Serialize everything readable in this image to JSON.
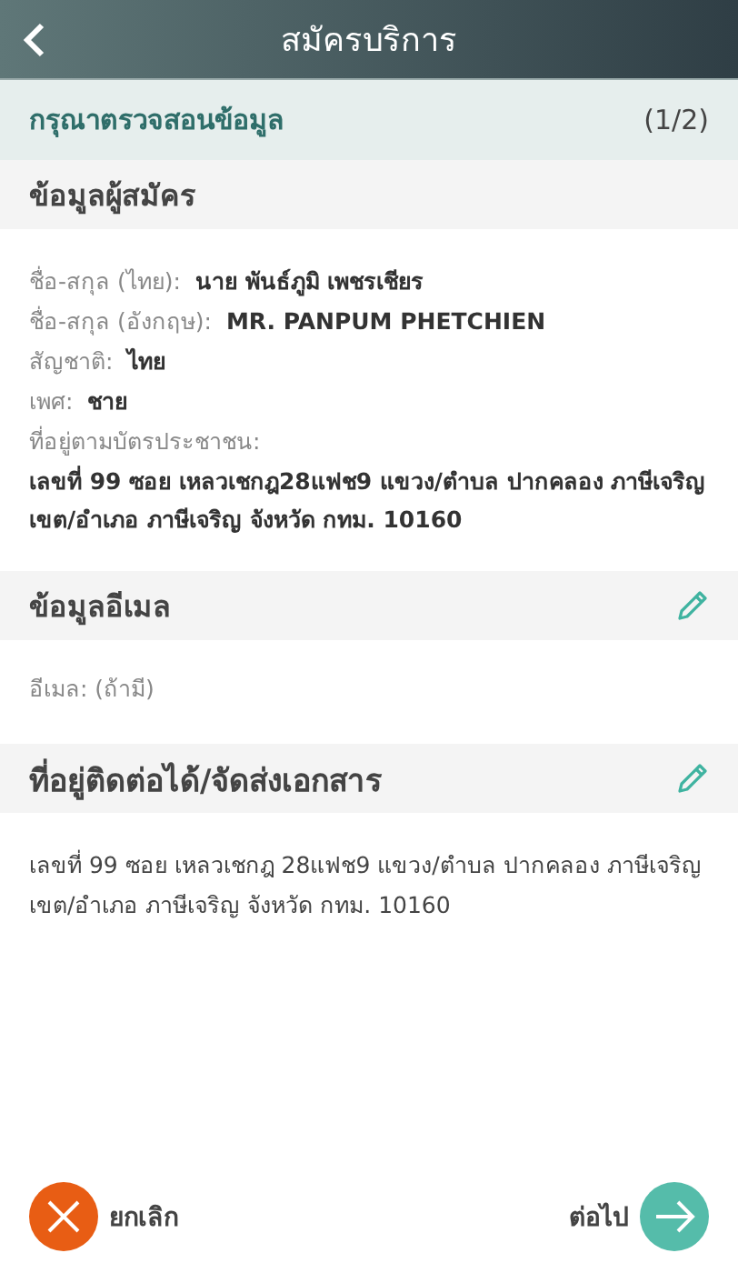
{
  "header": {
    "title": "สมัครบริการ"
  },
  "step": {
    "label": "กรุณาตรวจสอนข้อมูล",
    "count": "(1/2)"
  },
  "sections": [
    {
      "title": "ข้อมูลผู้สมัคร",
      "editable": false,
      "fields": [
        {
          "kind": "inline",
          "label": "ชื่อ-สกุล (ไทย):",
          "value": "นาย พันธ์ภูมิ เพชรเชียร"
        },
        {
          "kind": "inline",
          "label": "ชื่อ-สกุล (อังกฤษ):",
          "value": "MR. PANPUM PHETCHIEN"
        },
        {
          "kind": "inline",
          "label": "สัญชาติ:",
          "value": "ไทย"
        },
        {
          "kind": "inline",
          "label": "เพศ:",
          "value": "ชาย"
        },
        {
          "kind": "stacked",
          "label": "ที่อยู่ตามบัตรประชาชน:",
          "value": "เลขที่ 99 ซอย เหลวเชกฎ28แฟช9 แขวง/ตำบล ปากคลอง ภาษีเจริญ เขต/อำเภอ ภาษีเจริญ จังหวัด กทม. 10160"
        }
      ]
    },
    {
      "title": "ข้อมูลอีเมล",
      "editable": true,
      "fields": [
        {
          "kind": "inline",
          "label": "อีเมล: (ถ้ามี)"
        }
      ]
    },
    {
      "title": "ที่อยู่ติดต่อได้/จัดส่งเอกสาร",
      "editable": true,
      "fields": [
        {
          "kind": "text",
          "value": "เลขที่ 99 ซอย เหลวเชกฎ 28แฟช9 แขวง/ตำบล ปากคลอง ภาษีเจริญ เขต/อำเภอ ภาษีเจริญ จังหวัด กทม. 10160"
        }
      ]
    }
  ],
  "footer": {
    "cancel": "ยกเลิก",
    "next": "ต่อไป"
  }
}
